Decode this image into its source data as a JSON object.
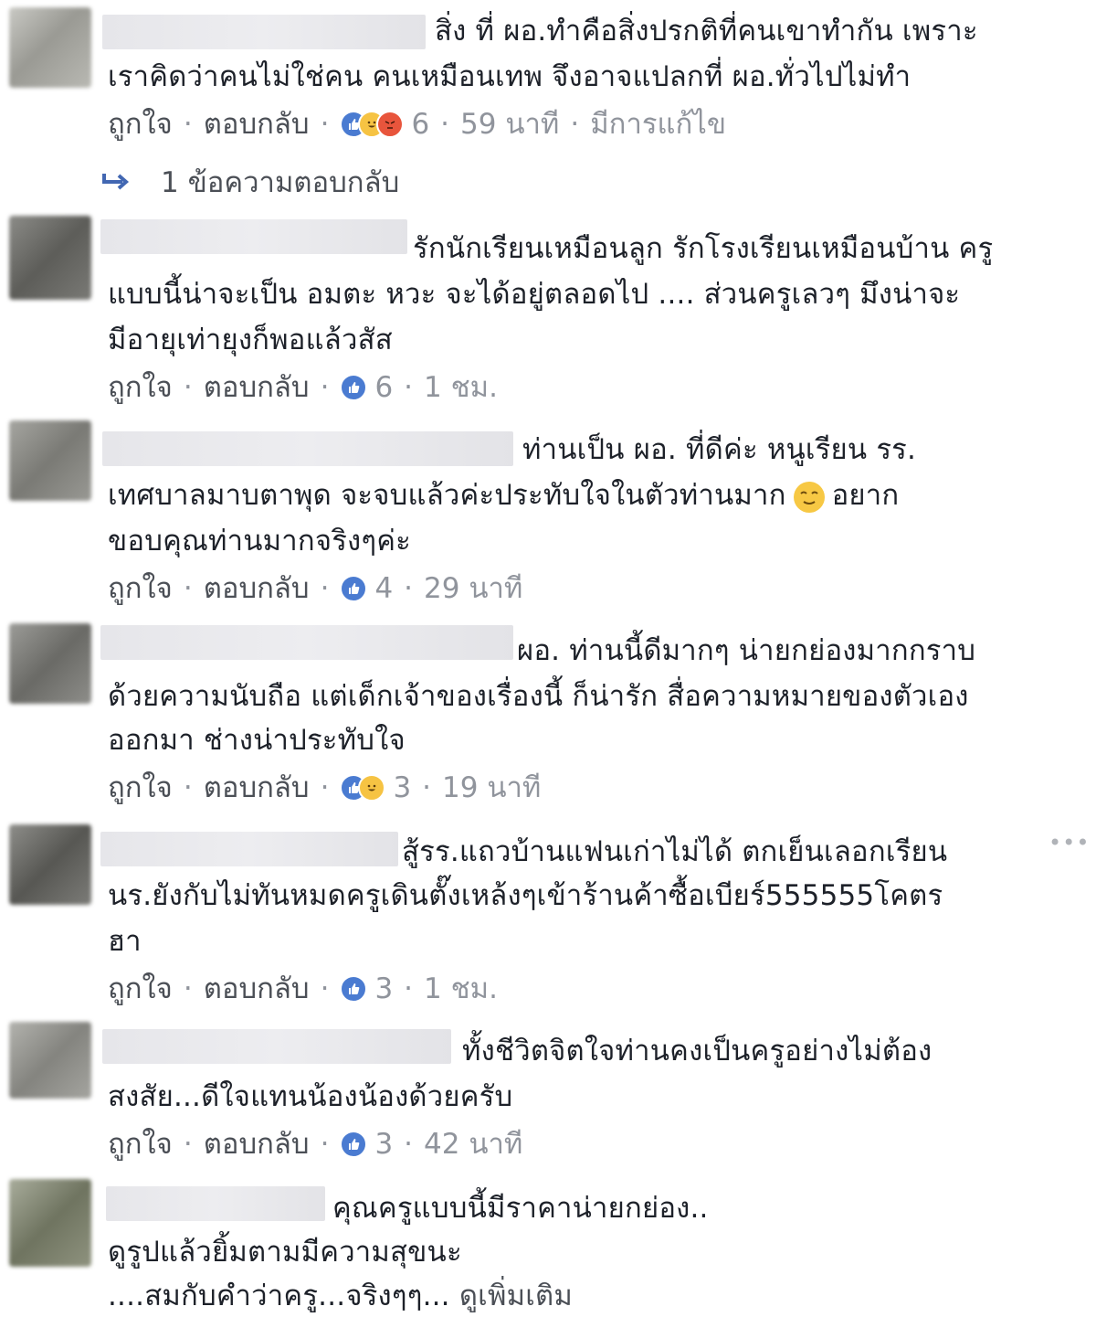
{
  "labels": {
    "like": "ถูกใจ",
    "reply": "ตอบกลับ",
    "sep": "·"
  },
  "comments": [
    {
      "lines": [
        "สิ่ง ที่ ผอ.ทำคือสิ่งปรกติที่คนเขาทำกัน เพราะ",
        "เราคิดว่าคนไม่ใช่คน คนเหมือนเทพ จึงอาจแปลกที่ ผอ.ทั่วไปไม่ทำ"
      ],
      "reaction_count": "6",
      "time": "59 นาที",
      "edited": "มีการแก้ไข",
      "reactions": [
        "like-icon",
        "haha-icon",
        "angry-icon"
      ]
    },
    {
      "lines": [
        "รักนักเรียนเหมือนลูก รักโรงเรียนเหมือนบ้าน ครู",
        "แบบนี้น่าจะเป็น อมตะ หวะ จะได้อยู่ตลอดไป .... ส่วนครูเลวๆ มึงน่าจะ",
        "มีอายุเท่ายุงก็พอแล้วสัส"
      ],
      "reaction_count": "6",
      "time": "1 ชม.",
      "reactions": [
        "like-icon"
      ]
    },
    {
      "lines": [
        "ท่านเป็น ผอ. ที่ดีค่ะ หนูเรียน รร.",
        "เทศบาลมาบตาพุด จะจบแล้วค่ะประทับใจในตัวท่านมาก",
        "ขอบคุณท่านมากจริงๆค่ะ"
      ],
      "line2_after": "อยาก",
      "reaction_count": "4",
      "time": "29 นาที",
      "reactions": [
        "like-icon"
      ]
    },
    {
      "lines": [
        "ผอ. ท่านนี้ดีมากๆ น่ายกย่องมากกราบ",
        "ด้วยความนับถือ แต่เด็กเจ้าของเรื่องนี้ ก็น่ารัก สื่อความหมายของตัวเอง",
        "ออกมา ช่างน่าประทับใจ"
      ],
      "reaction_count": "3",
      "time": "19 นาที",
      "reactions": [
        "like-icon",
        "haha-icon"
      ]
    },
    {
      "lines": [
        "สู้รร.แถวบ้านแฟนเก่าไม่ได้ ตกเย็นเลอกเรียน",
        "นร.ยังกับไม่ทันหมดครูเดินตั๊งเหล้งๆเข้าร้านค้าซื้อเบียร์555555โคตร",
        "ฮา"
      ],
      "more": "•••",
      "reaction_count": "3",
      "time": "1 ชม.",
      "reactions": [
        "like-icon"
      ]
    },
    {
      "lines": [
        "ทั้งชีวิตจิตใจท่านคงเป็นครูอย่างไม่ต้อง",
        "สงสัย...ดีใจแทนน้องน้องด้วยครับ"
      ],
      "reaction_count": "3",
      "time": "42 นาที",
      "reactions": [
        "like-icon"
      ]
    },
    {
      "lines": [
        "คุณครูแบบนี้มีราคาน่ายกย่อง..",
        "ดูรูปแล้วยิ้มตามมีความสุขนะ",
        "....สมกับคำว่าครู...จริงๆๆ..."
      ],
      "see_more": "ดูเพิ่มเติม"
    }
  ],
  "replies_link": "1 ข้อความตอบกลับ",
  "colors": {
    "text": "#1d2129",
    "meta": "#90949c",
    "link": "#4b4f56",
    "like_blue": "#4a7bd1",
    "reply_arrow": "#4267b2"
  }
}
